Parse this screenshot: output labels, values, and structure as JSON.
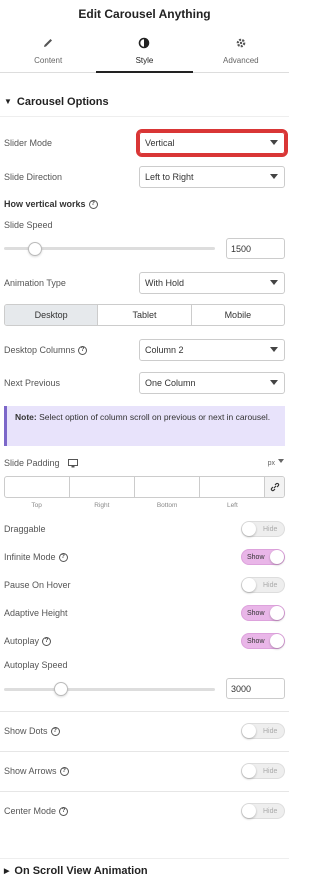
{
  "header": {
    "title": "Edit Carousel Anything"
  },
  "tabs": [
    {
      "label": "Content",
      "icon": "pencil-icon"
    },
    {
      "label": "Style",
      "icon": "contrast-icon"
    },
    {
      "label": "Advanced",
      "icon": "gear-icon"
    }
  ],
  "carousel_options": {
    "title": "Carousel Options",
    "slider_mode": {
      "label": "Slider Mode",
      "value": "Vertical"
    },
    "slide_direction": {
      "label": "Slide Direction",
      "value": "Left to Right"
    },
    "how_vertical": {
      "label": "How vertical works"
    },
    "slide_speed": {
      "label": "Slide Speed",
      "value": "1500"
    },
    "animation_type": {
      "label": "Animation Type",
      "value": "With Hold"
    },
    "devices": [
      "Desktop",
      "Tablet",
      "Mobile"
    ],
    "desktop_columns": {
      "label": "Desktop Columns",
      "value": "Column 2"
    },
    "next_previous": {
      "label": "Next Previous",
      "value": "One Column"
    },
    "note": {
      "bold": "Note:",
      "text": " Select option of column scroll on previous or next in carousel."
    },
    "slide_padding": {
      "label": "Slide Padding",
      "unit": "px",
      "sides": [
        "Top",
        "Right",
        "Bottom",
        "Left"
      ]
    },
    "draggable": {
      "label": "Draggable",
      "state": "Hide"
    },
    "infinite_mode": {
      "label": "Infinite Mode",
      "state": "Show"
    },
    "pause_on_hover": {
      "label": "Pause On Hover",
      "state": "Hide"
    },
    "adaptive_height": {
      "label": "Adaptive Height",
      "state": "Show"
    },
    "autoplay": {
      "label": "Autoplay",
      "state": "Show"
    },
    "autoplay_speed": {
      "label": "Autoplay Speed",
      "value": "3000"
    },
    "show_dots": {
      "label": "Show Dots",
      "state": "Hide"
    },
    "show_arrows": {
      "label": "Show Arrows",
      "state": "Hide"
    },
    "center_mode": {
      "label": "Center Mode",
      "state": "Hide"
    }
  },
  "scroll_view_animation": {
    "title": "On Scroll View Animation"
  },
  "colors": {
    "highlight": "#d93636",
    "toggle_on": "#e9b6e8",
    "note_bg": "#e8e3fb"
  }
}
